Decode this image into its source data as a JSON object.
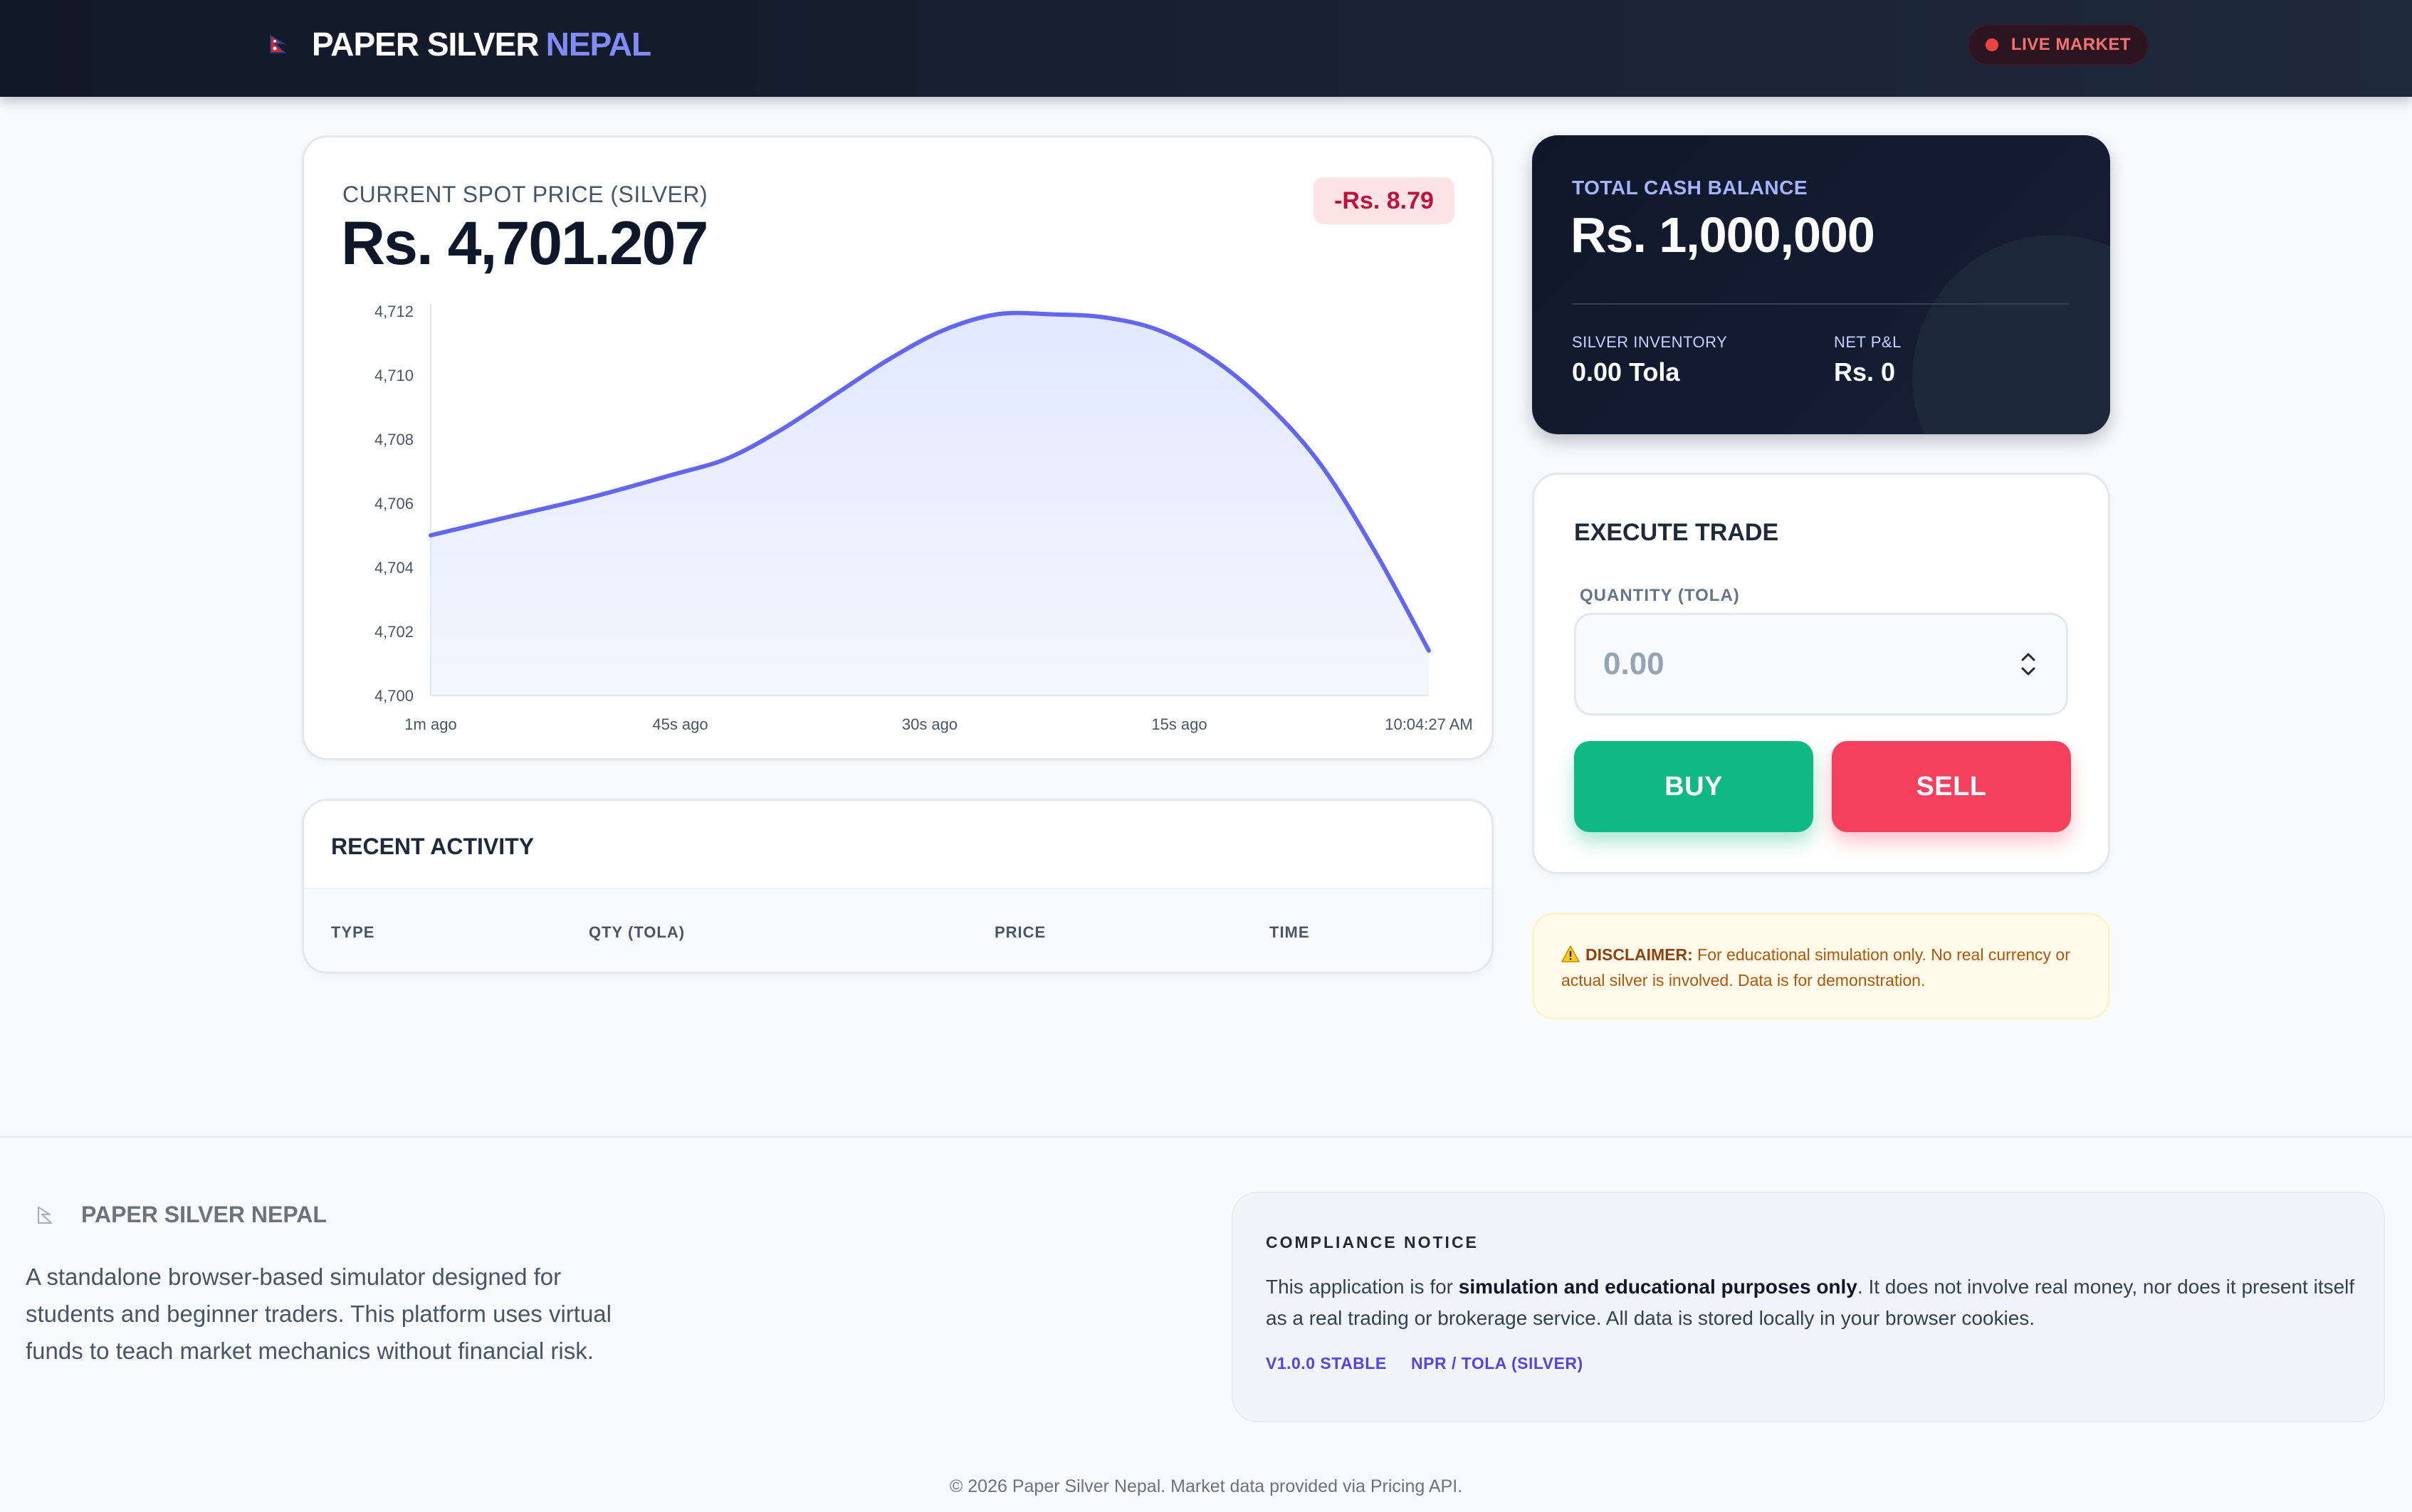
{
  "header": {
    "brand_main": "PAPER SILVER",
    "brand_accent": "NEPAL",
    "live_label": "LIVE MARKET",
    "accent_color": "#818cf8",
    "live_color": "#ef4444"
  },
  "spot": {
    "label": "CURRENT SPOT PRICE (SILVER)",
    "value": "Rs. 4,701.207",
    "change": "-Rs. 8.79",
    "change_color": "#be123c"
  },
  "chart_data": {
    "type": "area",
    "x_labels": [
      "1m ago",
      "45s ago",
      "30s ago",
      "15s ago",
      "10:04:27 AM"
    ],
    "y_ticks": [
      "4,700",
      "4,702",
      "4,704",
      "4,706",
      "4,708",
      "4,710",
      "4,712"
    ],
    "ylim": [
      4700,
      4712
    ],
    "points": [
      [
        0,
        4705.0
      ],
      [
        6,
        4705.6
      ],
      [
        12,
        4706.2
      ],
      [
        18,
        4706.9
      ],
      [
        22,
        4707.4
      ],
      [
        26,
        4708.3
      ],
      [
        30,
        4709.4
      ],
      [
        34,
        4710.5
      ],
      [
        38,
        4711.4
      ],
      [
        42,
        4711.9
      ],
      [
        46,
        4711.9
      ],
      [
        50,
        4711.8
      ],
      [
        54,
        4711.4
      ],
      [
        58,
        4710.5
      ],
      [
        62,
        4709.1
      ],
      [
        66,
        4707.2
      ],
      [
        70,
        4704.5
      ],
      [
        74,
        4701.4
      ]
    ],
    "x_range": [
      0,
      74
    ],
    "line_color": "#6366f1",
    "fill_color": "#e0e7ff",
    "grid": false
  },
  "activity": {
    "title": "RECENT ACTIVITY",
    "columns": [
      "TYPE",
      "QTY (TOLA)",
      "PRICE",
      "TIME"
    ]
  },
  "balance": {
    "label": "TOTAL CASH BALANCE",
    "value": "Rs. 1,000,000",
    "inventory_label": "SILVER INVENTORY",
    "inventory_value": "0.00 Tola",
    "pnl_label": "NET P&L",
    "pnl_value": "Rs. 0"
  },
  "trade": {
    "title": "EXECUTE TRADE",
    "qty_label": "QUANTITY (TOLA)",
    "qty_placeholder": "0.00",
    "buy_label": "BUY",
    "sell_label": "SELL",
    "buy_color": "#10b981",
    "sell_color": "#f43f5e"
  },
  "disclaimer": {
    "heading": "DISCLAIMER:",
    "text": "For educational simulation only. No real currency or actual silver is involved. Data is for demonstration."
  },
  "footer": {
    "brand": "PAPER SILVER NEPAL",
    "description": "A standalone browser-based simulator designed for students and beginner traders. This platform uses virtual funds to teach market mechanics without financial risk.",
    "compliance_title": "COMPLIANCE NOTICE",
    "compliance_pre": "This application is for ",
    "compliance_strong": "simulation and educational purposes only",
    "compliance_post": ". It does not involve real money, nor does it present itself as a real trading or brokerage service. All data is stored locally in your browser cookies.",
    "tag_version": "V1.0.0 STABLE",
    "tag_pair": "NPR / TOLA (SILVER)",
    "copyright": "© 2026 Paper Silver Nepal. Market data provided via Pricing API."
  }
}
